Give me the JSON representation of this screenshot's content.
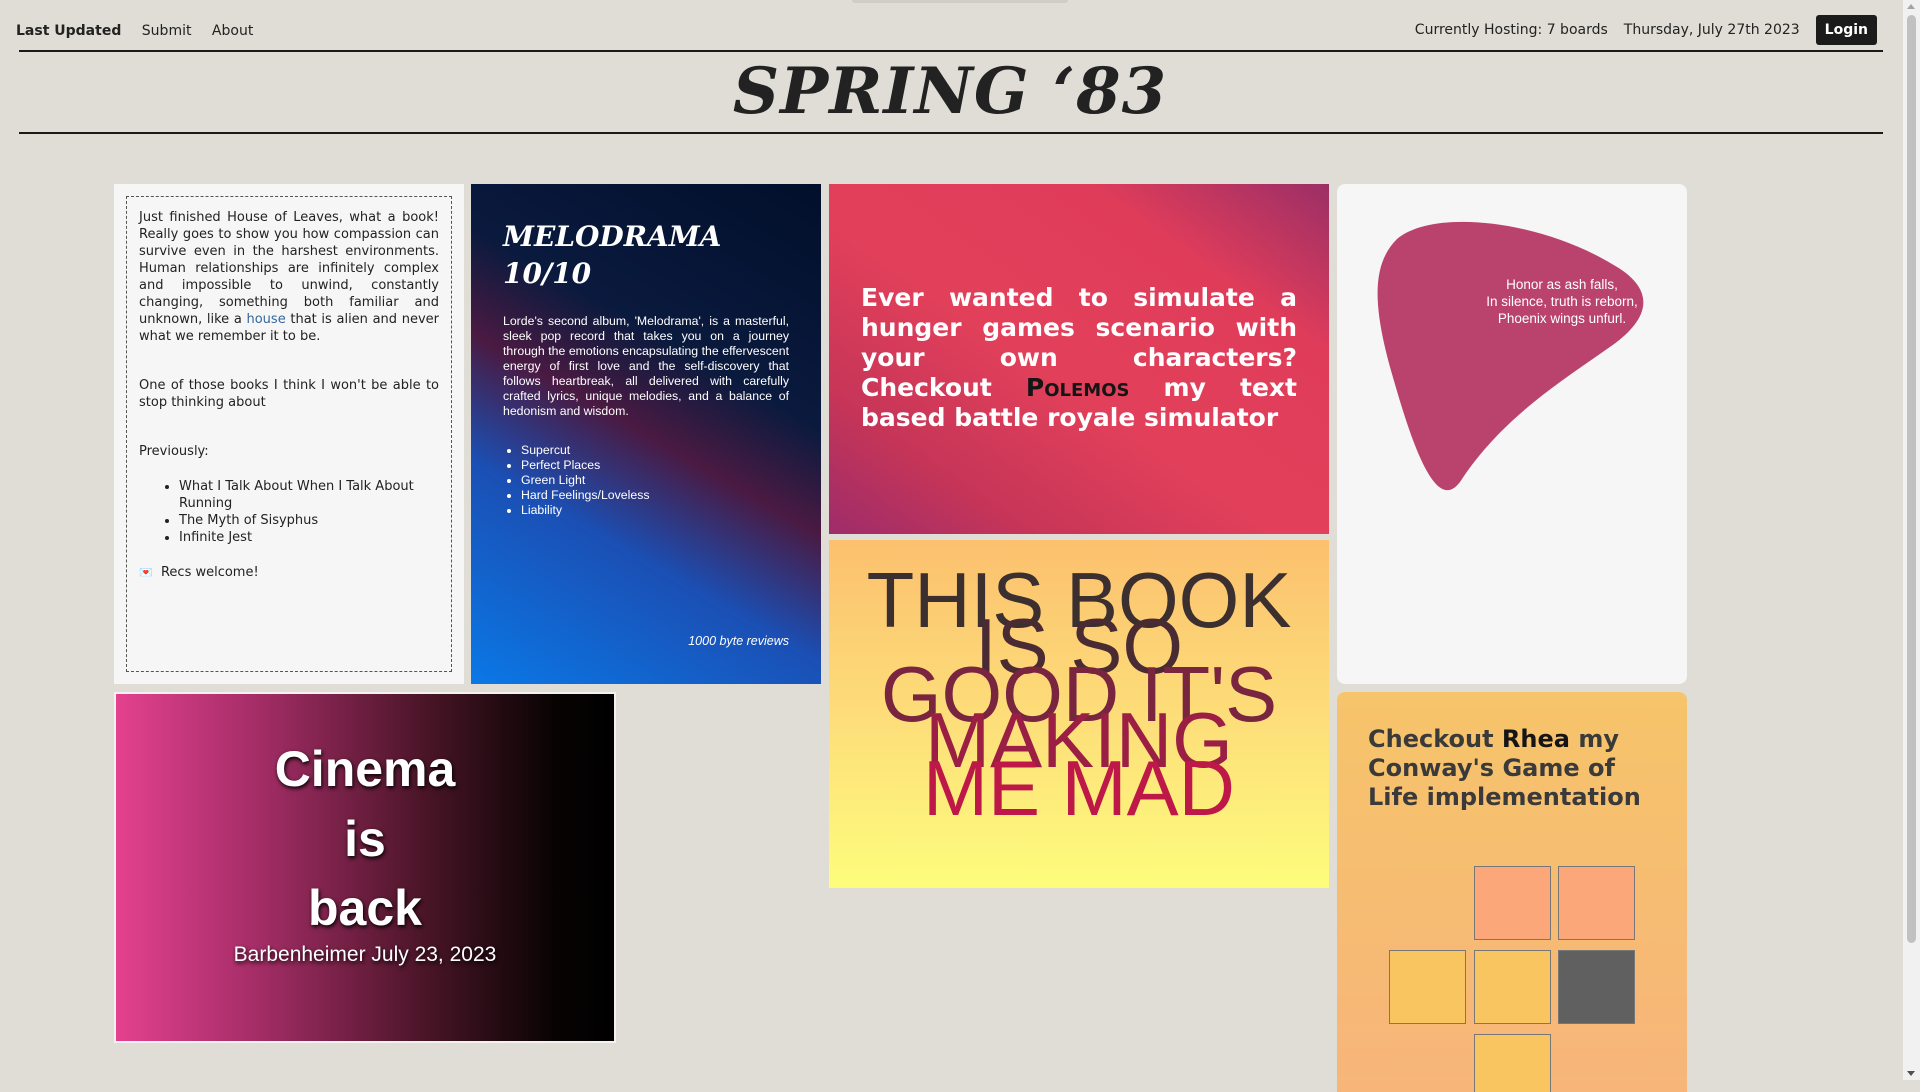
{
  "nav": {
    "links": [
      "Last Updated",
      "Submit",
      "About"
    ],
    "hosting": "Currently Hosting: 7 boards",
    "date": "Thursday, July 27th 2023",
    "login": "Login"
  },
  "masthead": "SPRING ‘83",
  "note": {
    "para1_before": "Just finished House of Leaves, what a book! Really goes to show you how compassion can survive even in the harshest environments. Human relationships are infinitely complex and impossible to unwind, constantly changing, something both familiar and unknown, like a ",
    "link": "house",
    "para1_after": " that is alien and never what we remember it to be.",
    "para2": "One of those books I think I won't be able to stop thinking about",
    "previously": "Previously:",
    "books": [
      "What I Talk About When I Talk About Running",
      "The Myth of Sisyphus",
      "Infinite Jest"
    ],
    "heart": "💌",
    "recs": "Recs welcome!"
  },
  "melodrama": {
    "title1": "MELODRAMA",
    "title2": "10/10",
    "body": "Lorde's second album, 'Melodrama', is a masterful, sleek pop record that takes you on a journey through the emotions encapsulating the effervescent energy of first love and the self-discovery that follows heartbreak, all delivered with carefully crafted lyrics, unique melodies, and a balance of hedonism and wisdom.",
    "tracks": [
      "Supercut",
      "Perfect Places",
      "Green Light",
      "Hard Feelings/Loveless",
      "Liability"
    ],
    "signature": "1000 byte reviews"
  },
  "polemos": {
    "before": "Ever wanted to simulate a hunger games scenario with your own characters? Checkout ",
    "brand": "Polemos",
    "after": " my text based battle royale simulator"
  },
  "haiku": {
    "line1": "Honor as ash falls,",
    "line2": "In silence, truth is reborn,",
    "line3": "Phoenix wings unfurl.",
    "blob_color": "#b9436d"
  },
  "cinema": {
    "line1": "Cinema",
    "line2": "is",
    "line3": "back",
    "sub": "Barbenheimer July 23, 2023"
  },
  "book": {
    "lines": [
      "THIS BOOK",
      "IS SO",
      "GOOD IT'S",
      "MAKING",
      "ME MAD"
    ],
    "colors": [
      "#3b2f2f",
      "#4a2b33",
      "#7a2540",
      "#9b1f45",
      "#bd1848"
    ]
  },
  "rhea": {
    "before": "Checkout ",
    "brand": "Rhea",
    "after": " my Conway's Game of Life implementation",
    "colors": {
      "salmon": "#fba77a",
      "yellow": "#f8c560",
      "dark": "#606060"
    }
  }
}
